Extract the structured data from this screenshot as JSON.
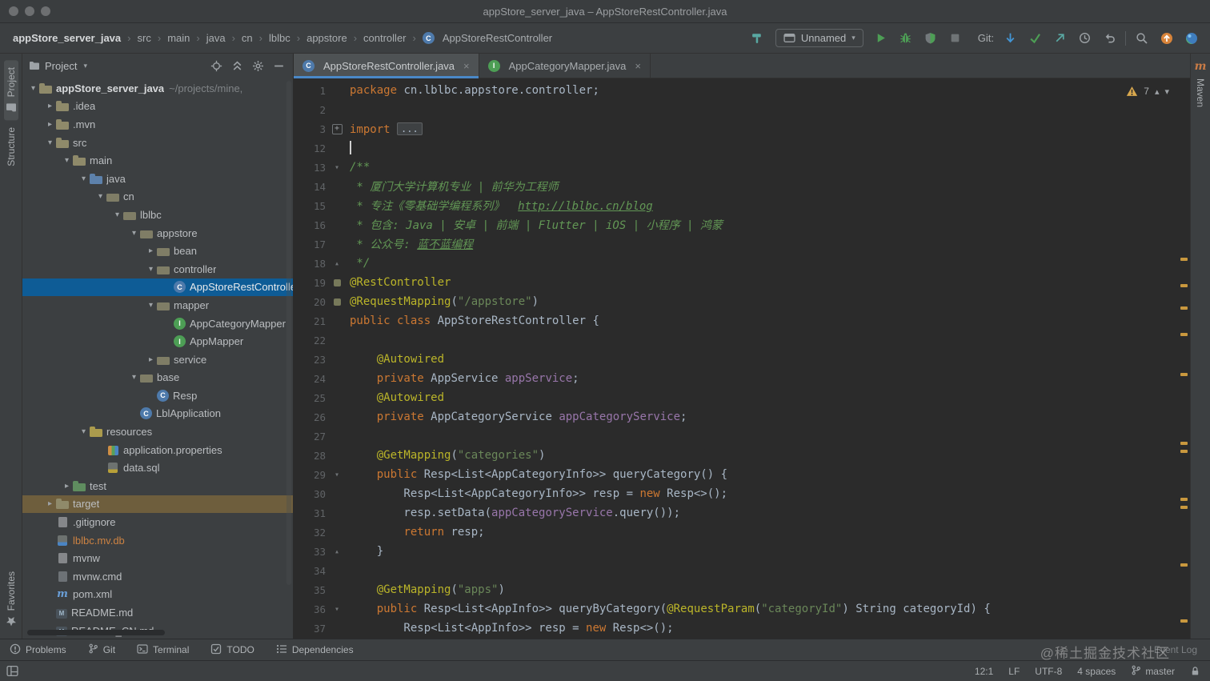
{
  "colors": {
    "selection_blue": "#0e5c96",
    "target_highlight": "#6e5e3d",
    "accent_blue": "#4a88c7",
    "warning_stripe_mark": "#c9983e",
    "orange_file": "#cc8242"
  },
  "titlebar": {
    "title": "appStore_server_java – AppStoreRestController.java"
  },
  "navbar": {
    "breadcrumbs": [
      "appStore_server_java",
      "src",
      "main",
      "java",
      "cn",
      "lblbc",
      "appstore",
      "controller",
      "AppStoreRestController"
    ],
    "run_config_label": "Unnamed",
    "git_label": "Git:"
  },
  "left_stripe": {
    "project_label": "Project",
    "structure_label": "Structure",
    "favorites_label": "Favorites"
  },
  "right_stripe": {
    "maven_label": "Maven"
  },
  "project_panel": {
    "header_title": "Project",
    "tree": [
      {
        "depth": 0,
        "chevron": "open",
        "icon": "folder-project",
        "label": "appStore_server_java",
        "suffix": "~/projects/mine,",
        "bold": true
      },
      {
        "depth": 1,
        "chevron": "closed",
        "icon": "folder",
        "label": ".idea"
      },
      {
        "depth": 1,
        "chevron": "closed",
        "icon": "folder",
        "label": ".mvn"
      },
      {
        "depth": 1,
        "chevron": "open",
        "icon": "folder",
        "label": "src"
      },
      {
        "depth": 2,
        "chevron": "open",
        "icon": "folder",
        "label": "main"
      },
      {
        "depth": 3,
        "chevron": "open",
        "icon": "srcroot",
        "label": "java"
      },
      {
        "depth": 4,
        "chevron": "open",
        "icon": "package",
        "label": "cn"
      },
      {
        "depth": 5,
        "chevron": "open",
        "icon": "package",
        "label": "lblbc"
      },
      {
        "depth": 6,
        "chevron": "open",
        "icon": "package",
        "label": "appstore"
      },
      {
        "depth": 7,
        "chevron": "closed",
        "icon": "package",
        "label": "bean"
      },
      {
        "depth": 7,
        "chevron": "open",
        "icon": "package",
        "label": "controller"
      },
      {
        "depth": 8,
        "chevron": null,
        "icon": "class",
        "label": "AppStoreRestController",
        "state": "selected"
      },
      {
        "depth": 7,
        "chevron": "open",
        "icon": "package",
        "label": "mapper"
      },
      {
        "depth": 8,
        "chevron": null,
        "icon": "interface",
        "label": "AppCategoryMapper"
      },
      {
        "depth": 8,
        "chevron": null,
        "icon": "interface",
        "label": "AppMapper"
      },
      {
        "depth": 7,
        "chevron": "closed",
        "icon": "package",
        "label": "service"
      },
      {
        "depth": 6,
        "chevron": "open",
        "icon": "package",
        "label": "base"
      },
      {
        "depth": 7,
        "chevron": null,
        "icon": "class",
        "label": "Resp"
      },
      {
        "depth": 6,
        "chevron": null,
        "icon": "class",
        "label": "LblApplication"
      },
      {
        "depth": 3,
        "chevron": "open",
        "icon": "resroot",
        "label": "resources"
      },
      {
        "depth": 4,
        "chevron": null,
        "icon": "props",
        "label": "application.properties"
      },
      {
        "depth": 4,
        "chevron": null,
        "icon": "sql",
        "label": "data.sql"
      },
      {
        "depth": 2,
        "chevron": "closed",
        "icon": "testroot",
        "label": "test"
      },
      {
        "depth": 1,
        "chevron": "closed",
        "icon": "excluded",
        "label": "target",
        "state": "target"
      },
      {
        "depth": 1,
        "chevron": null,
        "icon": "file",
        "label": ".gitignore"
      },
      {
        "depth": 1,
        "chevron": null,
        "icon": "db",
        "label": "lblbc.mv.db",
        "colored": "orange"
      },
      {
        "depth": 1,
        "chevron": null,
        "icon": "file",
        "label": "mvnw"
      },
      {
        "depth": 1,
        "chevron": null,
        "icon": "cmd",
        "label": "mvnw.cmd"
      },
      {
        "depth": 1,
        "chevron": null,
        "icon": "maven",
        "label": "pom.xml"
      },
      {
        "depth": 1,
        "chevron": null,
        "icon": "md",
        "label": "README.md"
      },
      {
        "depth": 1,
        "chevron": null,
        "icon": "md",
        "label": "README_CN.md"
      }
    ]
  },
  "editor": {
    "tabs": [
      {
        "label": "AppStoreRestController.java",
        "icon": "class",
        "active": true
      },
      {
        "label": "AppCategoryMapper.java",
        "icon": "interface",
        "active": false
      }
    ],
    "inspection": {
      "warnings": "7"
    },
    "stripe_marks": [
      224,
      257,
      285,
      318,
      368,
      454,
      464,
      524,
      534,
      606,
      676
    ],
    "lines": [
      {
        "n": "1",
        "s": [
          [
            "package ",
            "kw"
          ],
          [
            "cn.lblbc.appstore.controller;",
            "pl"
          ]
        ]
      },
      {
        "n": "2",
        "s": []
      },
      {
        "n": "3",
        "g": "plus",
        "s": [
          [
            "import ",
            "kw"
          ],
          [
            "...",
            "fold"
          ]
        ]
      },
      {
        "n": "12",
        "caret": true,
        "s": []
      },
      {
        "n": "13",
        "g": "open",
        "s": [
          [
            "/**",
            "doc"
          ]
        ]
      },
      {
        "n": "14",
        "s": [
          [
            " * 厦门大学计算机专业 | 前华为工程师",
            "doc"
          ]
        ]
      },
      {
        "n": "15",
        "s": [
          [
            " * 专注《零基础学编程系列》  ",
            "doc"
          ],
          [
            "http://lblbc.cn/blog",
            "doclink"
          ]
        ]
      },
      {
        "n": "16",
        "s": [
          [
            " * 包含: Java | 安卓 | 前端 | Flutter | iOS | 小程序 | 鸿蒙",
            "doc"
          ]
        ]
      },
      {
        "n": "17",
        "s": [
          [
            " * 公众号: ",
            "doc"
          ],
          [
            "蓝不蓝编程",
            "doclink"
          ]
        ]
      },
      {
        "n": "18",
        "g": "close",
        "s": [
          [
            " */",
            "doc"
          ]
        ]
      },
      {
        "n": "19",
        "g": "bean",
        "s": [
          [
            "@RestController",
            "ann"
          ]
        ]
      },
      {
        "n": "20",
        "g": "bean",
        "s": [
          [
            "@RequestMapping",
            "ann"
          ],
          [
            "(",
            "pl"
          ],
          [
            "\"/appstore\"",
            "str"
          ],
          [
            ")",
            "pl"
          ]
        ]
      },
      {
        "n": "21",
        "s": [
          [
            "public class ",
            "kw"
          ],
          [
            "AppStoreRestController {",
            "pl"
          ]
        ]
      },
      {
        "n": "22",
        "s": []
      },
      {
        "n": "23",
        "s": [
          [
            "    ",
            "pl"
          ],
          [
            "@Autowired",
            "ann"
          ]
        ]
      },
      {
        "n": "24",
        "s": [
          [
            "    ",
            "pl"
          ],
          [
            "private ",
            "kw"
          ],
          [
            "AppService ",
            "pl"
          ],
          [
            "appService",
            "fld"
          ],
          [
            ";",
            "pl"
          ]
        ]
      },
      {
        "n": "25",
        "s": [
          [
            "    ",
            "pl"
          ],
          [
            "@Autowired",
            "ann"
          ]
        ]
      },
      {
        "n": "26",
        "s": [
          [
            "    ",
            "pl"
          ],
          [
            "private ",
            "kw"
          ],
          [
            "AppCategoryService ",
            "pl"
          ],
          [
            "appCategoryService",
            "fld"
          ],
          [
            ";",
            "pl"
          ]
        ]
      },
      {
        "n": "27",
        "s": []
      },
      {
        "n": "28",
        "s": [
          [
            "    ",
            "pl"
          ],
          [
            "@GetMapping",
            "ann"
          ],
          [
            "(",
            "pl"
          ],
          [
            "\"categories\"",
            "str"
          ],
          [
            ")",
            "pl"
          ]
        ]
      },
      {
        "n": "29",
        "g": "open",
        "s": [
          [
            "    ",
            "pl"
          ],
          [
            "public ",
            "kw"
          ],
          [
            "Resp<List<AppCategoryInfo>> queryCategory() {",
            "pl"
          ]
        ]
      },
      {
        "n": "30",
        "s": [
          [
            "        Resp<List<AppCategoryInfo>> resp = ",
            "pl"
          ],
          [
            "new ",
            "kw"
          ],
          [
            "Resp<>();",
            "pl"
          ]
        ]
      },
      {
        "n": "31",
        "s": [
          [
            "        resp.setData(",
            "pl"
          ],
          [
            "appCategoryService",
            "fld"
          ],
          [
            ".query());",
            "pl"
          ]
        ]
      },
      {
        "n": "32",
        "s": [
          [
            "        ",
            "pl"
          ],
          [
            "return ",
            "kw"
          ],
          [
            "resp;",
            "pl"
          ]
        ]
      },
      {
        "n": "33",
        "g": "close",
        "s": [
          [
            "    }",
            "pl"
          ]
        ]
      },
      {
        "n": "34",
        "s": []
      },
      {
        "n": "35",
        "s": [
          [
            "    ",
            "pl"
          ],
          [
            "@GetMapping",
            "ann"
          ],
          [
            "(",
            "pl"
          ],
          [
            "\"apps\"",
            "str"
          ],
          [
            ")",
            "pl"
          ]
        ]
      },
      {
        "n": "36",
        "g": "open",
        "s": [
          [
            "    ",
            "pl"
          ],
          [
            "public ",
            "kw"
          ],
          [
            "Resp<List<AppInfo>> queryByCategory(",
            "pl"
          ],
          [
            "@RequestParam",
            "ann"
          ],
          [
            "(",
            "pl"
          ],
          [
            "\"categoryId\"",
            "str"
          ],
          [
            ") String categoryId) {",
            "pl"
          ]
        ]
      },
      {
        "n": "37",
        "s": [
          [
            "        Resp<List<AppInfo>> resp = ",
            "pl"
          ],
          [
            "new ",
            "kw"
          ],
          [
            "Resp<>();",
            "pl"
          ]
        ]
      }
    ]
  },
  "toolrow": {
    "left": [
      {
        "name": "problems",
        "label": "Problems"
      },
      {
        "name": "git",
        "label": "Git"
      },
      {
        "name": "terminal",
        "label": "Terminal"
      },
      {
        "name": "todo",
        "label": "TODO"
      },
      {
        "name": "dependencies",
        "label": "Dependencies"
      }
    ],
    "event_log": "Event Log",
    "watermark": "@稀土掘金技术社区"
  },
  "statusbar": {
    "items": [
      {
        "name": "caret-position",
        "label": "12:1"
      },
      {
        "name": "line-separator",
        "label": "LF"
      },
      {
        "name": "encoding",
        "label": "UTF-8"
      },
      {
        "name": "indent",
        "label": "4 spaces"
      }
    ],
    "branch": "master"
  }
}
